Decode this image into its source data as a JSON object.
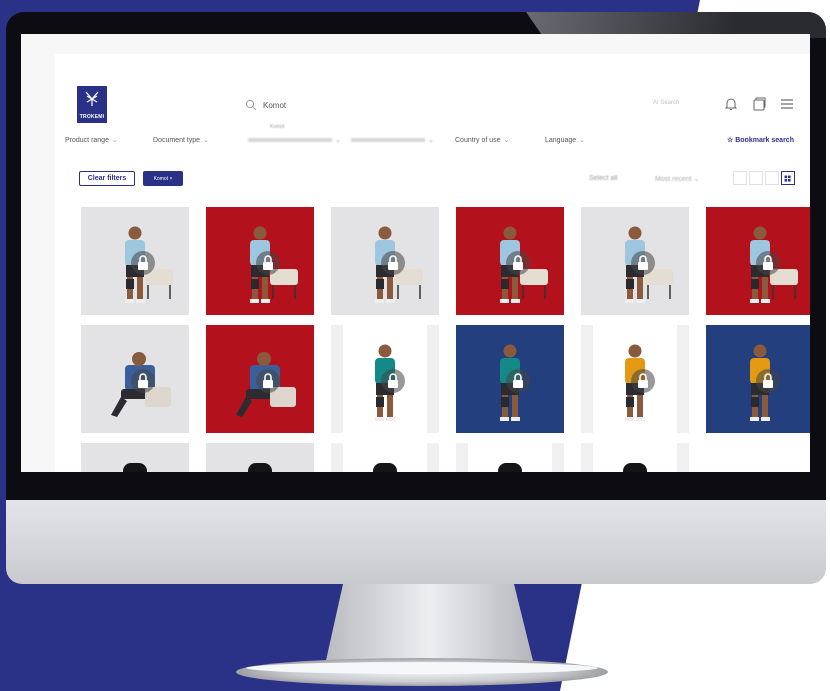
{
  "brand": {
    "logo_text": "TROKEMI"
  },
  "search": {
    "value": "Komot"
  },
  "header": {
    "ai_label": "AI Search",
    "icons": [
      "bell-icon",
      "window-icon",
      "menu-icon"
    ]
  },
  "filters": {
    "items": [
      "Product range",
      "Document type",
      "",
      "",
      "Country of use",
      "Language"
    ],
    "small_label": "Komot",
    "bookmark_label": "☆ Bookmark search"
  },
  "toolbar": {
    "clear_label": "Clear filters",
    "chip_label": "Komot ×",
    "select_all_label": "Select all",
    "sort_label": "Most recent ⌄"
  },
  "colors": {
    "brand": "#2a3288",
    "background_shape": "#2a3288",
    "red_backdrop": "#b3121d",
    "blue_backdrop": "#233f7e"
  },
  "assets": [
    {
      "bg": "light",
      "subject": "man-light-shirt-chair",
      "locked": true
    },
    {
      "bg": "red",
      "subject": "man-light-shirt-chair",
      "locked": true
    },
    {
      "bg": "light",
      "subject": "man-light-shirt-chair",
      "locked": true
    },
    {
      "bg": "red",
      "subject": "man-light-shirt-chair",
      "locked": true
    },
    {
      "bg": "light",
      "subject": "man-light-shirt-chair",
      "locked": true
    },
    {
      "bg": "red",
      "subject": "man-light-shirt-chair",
      "locked": true
    },
    {
      "bg": "light",
      "subject": "man-seated-blue-shirt",
      "locked": true
    },
    {
      "bg": "red",
      "subject": "man-seated-blue-shirt",
      "locked": true
    },
    {
      "bg": "white",
      "subject": "man-teal-shirt-standing",
      "locked": true
    },
    {
      "bg": "blue",
      "subject": "man-teal-shirt-standing",
      "locked": true
    },
    {
      "bg": "white",
      "subject": "man-orange-shirt-standing",
      "locked": true
    },
    {
      "bg": "blue",
      "subject": "man-orange-shirt-standing",
      "locked": true
    },
    {
      "bg": "light",
      "subject": "knee-brace-product",
      "locked": false
    },
    {
      "bg": "light",
      "subject": "knee-brace-product",
      "locked": false
    },
    {
      "bg": "white",
      "subject": "knee-brace-product",
      "locked": false
    },
    {
      "bg": "white",
      "subject": "knee-brace-product",
      "locked": false
    },
    {
      "bg": "white",
      "subject": "knee-brace-product",
      "locked": false
    }
  ]
}
